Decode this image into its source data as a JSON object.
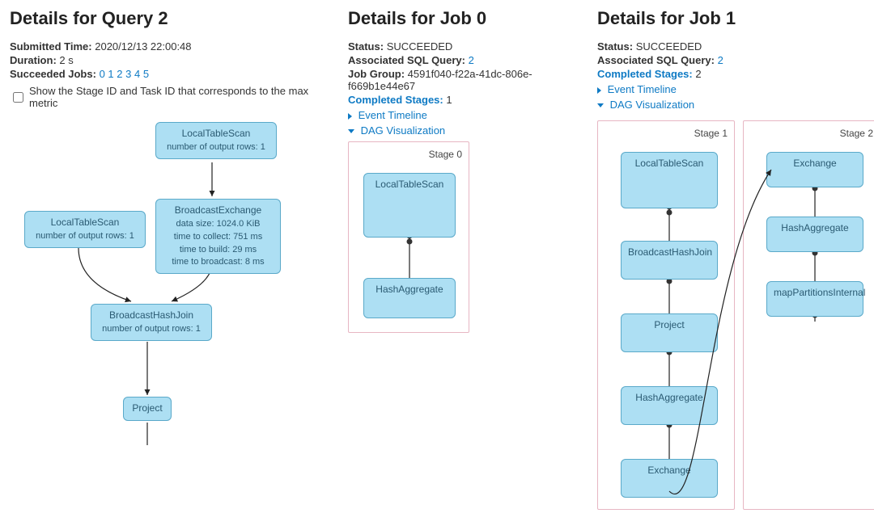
{
  "query": {
    "title": "Details for Query 2",
    "submitted_label": "Submitted Time:",
    "submitted_value": "2020/12/13 22:00:48",
    "duration_label": "Duration:",
    "duration_value": "2 s",
    "succeeded_label": "Succeeded Jobs:",
    "succeeded_jobs": [
      "0",
      "1",
      "2",
      "3",
      "4",
      "5"
    ],
    "checkbox_label": "Show the Stage ID and Task ID that corresponds to the max metric",
    "nodes": {
      "lts_top": {
        "title": "LocalTableScan",
        "sub": "number of output rows: 1"
      },
      "lts_left": {
        "title": "LocalTableScan",
        "sub": "number of output rows: 1"
      },
      "bex": {
        "title": "BroadcastExchange",
        "sub": "data size: 1024.0 KiB\ntime to collect: 751 ms\ntime to build: 29 ms\ntime to broadcast: 8 ms"
      },
      "bhj": {
        "title": "BroadcastHashJoin",
        "sub": "number of output rows: 1"
      },
      "proj": {
        "title": "Project"
      }
    }
  },
  "job0": {
    "title": "Details for Job 0",
    "status_label": "Status:",
    "status_value": "SUCCEEDED",
    "assoc_label": "Associated SQL Query:",
    "assoc_value": "2",
    "group_label": "Job Group:",
    "group_value": "4591f040-f22a-41dc-806e-f669b1e44e67",
    "completed_label": "Completed Stages:",
    "completed_value": "1",
    "event_timeline": "Event Timeline",
    "dag_viz": "DAG Visualization",
    "stage0_label": "Stage 0",
    "stage0_nodes": {
      "a": "LocalTableScan",
      "b": "HashAggregate"
    }
  },
  "job1": {
    "title": "Details for Job 1",
    "status_label": "Status:",
    "status_value": "SUCCEEDED",
    "assoc_label": "Associated SQL Query:",
    "assoc_value": "2",
    "completed_label": "Completed Stages:",
    "completed_value": "2",
    "event_timeline": "Event Timeline",
    "dag_viz": "DAG Visualization",
    "stage1_label": "Stage 1",
    "stage2_label": "Stage 2",
    "stage1_nodes": {
      "a": "LocalTableScan",
      "b": "BroadcastHashJoin",
      "c": "Project",
      "d": "HashAggregate",
      "e": "Exchange"
    },
    "stage2_nodes": {
      "a": "Exchange",
      "b": "HashAggregate",
      "c": "mapPartitionsInternal"
    }
  }
}
